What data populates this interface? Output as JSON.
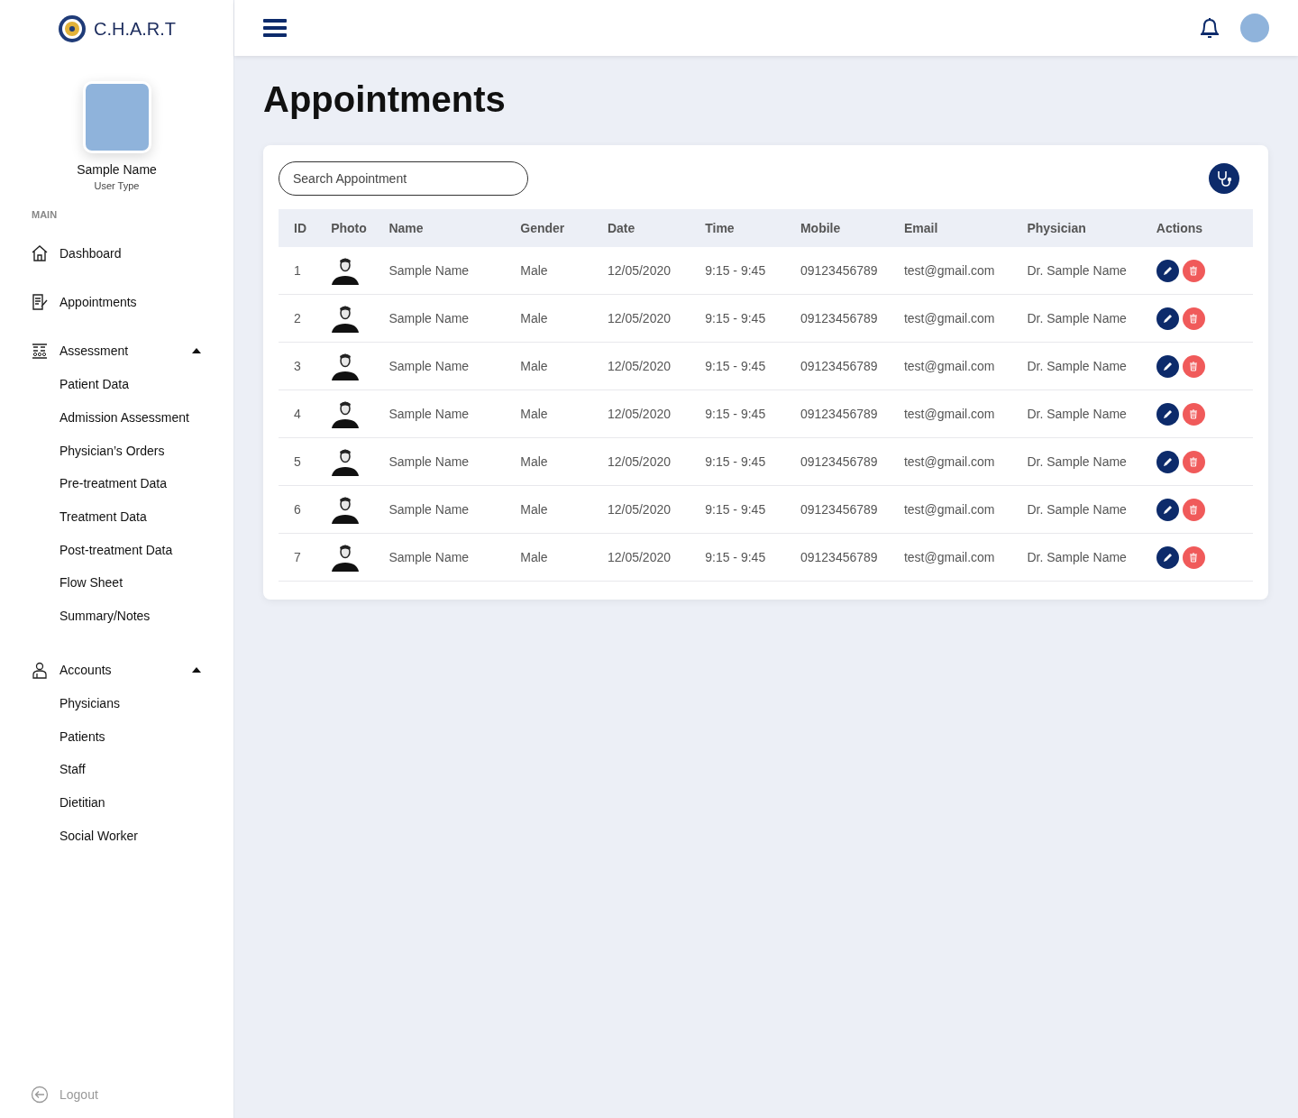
{
  "sidebar": {
    "brand": "C.H.A.R.T",
    "user": {
      "name": "Sample Name",
      "type": "User Type"
    },
    "section": "MAIN",
    "items": [
      {
        "label": "Dashboard"
      },
      {
        "label": "Appointments"
      },
      {
        "label": "Assessment",
        "expanded": true,
        "children": [
          {
            "label": "Patient Data"
          },
          {
            "label": "Admission Assessment"
          },
          {
            "label": "Physician’s Orders"
          },
          {
            "label": "Pre-treatment Data"
          },
          {
            "label": "Treatment Data"
          },
          {
            "label": "Post-treatment Data"
          },
          {
            "label": "Flow Sheet"
          },
          {
            "label": "Summary/Notes"
          }
        ]
      },
      {
        "label": "Accounts",
        "expanded": true,
        "children": [
          {
            "label": "Physicians"
          },
          {
            "label": "Patients"
          },
          {
            "label": "Staff"
          },
          {
            "label": "Dietitian"
          },
          {
            "label": "Social Worker"
          }
        ]
      }
    ],
    "logout": "Logout"
  },
  "page": {
    "title": "Appointments"
  },
  "search": {
    "placeholder": "Search Appointment"
  },
  "table": {
    "columns": [
      "ID",
      "Photo",
      "Name",
      "Gender",
      "Date",
      "Time",
      "Mobile",
      "Email",
      "Physician",
      "Actions"
    ],
    "rows": [
      {
        "id": "1",
        "name": "Sample Name",
        "gender": "Male",
        "date": "12/05/2020",
        "time": "9:15 - 9:45",
        "mobile": "09123456789",
        "email": "test@gmail.com",
        "physician": "Dr. Sample Name"
      },
      {
        "id": "2",
        "name": "Sample Name",
        "gender": "Male",
        "date": "12/05/2020",
        "time": "9:15 - 9:45",
        "mobile": "09123456789",
        "email": "test@gmail.com",
        "physician": "Dr. Sample Name"
      },
      {
        "id": "3",
        "name": "Sample Name",
        "gender": "Male",
        "date": "12/05/2020",
        "time": "9:15 - 9:45",
        "mobile": "09123456789",
        "email": "test@gmail.com",
        "physician": "Dr. Sample Name"
      },
      {
        "id": "4",
        "name": "Sample Name",
        "gender": "Male",
        "date": "12/05/2020",
        "time": "9:15 - 9:45",
        "mobile": "09123456789",
        "email": "test@gmail.com",
        "physician": "Dr. Sample Name"
      },
      {
        "id": "5",
        "name": "Sample Name",
        "gender": "Male",
        "date": "12/05/2020",
        "time": "9:15 - 9:45",
        "mobile": "09123456789",
        "email": "test@gmail.com",
        "physician": "Dr. Sample Name"
      },
      {
        "id": "6",
        "name": "Sample Name",
        "gender": "Male",
        "date": "12/05/2020",
        "time": "9:15 - 9:45",
        "mobile": "09123456789",
        "email": "test@gmail.com",
        "physician": "Dr. Sample Name"
      },
      {
        "id": "7",
        "name": "Sample Name",
        "gender": "Male",
        "date": "12/05/2020",
        "time": "9:15 - 9:45",
        "mobile": "09123456789",
        "email": "test@gmail.com",
        "physician": "Dr. Sample Name"
      }
    ]
  }
}
